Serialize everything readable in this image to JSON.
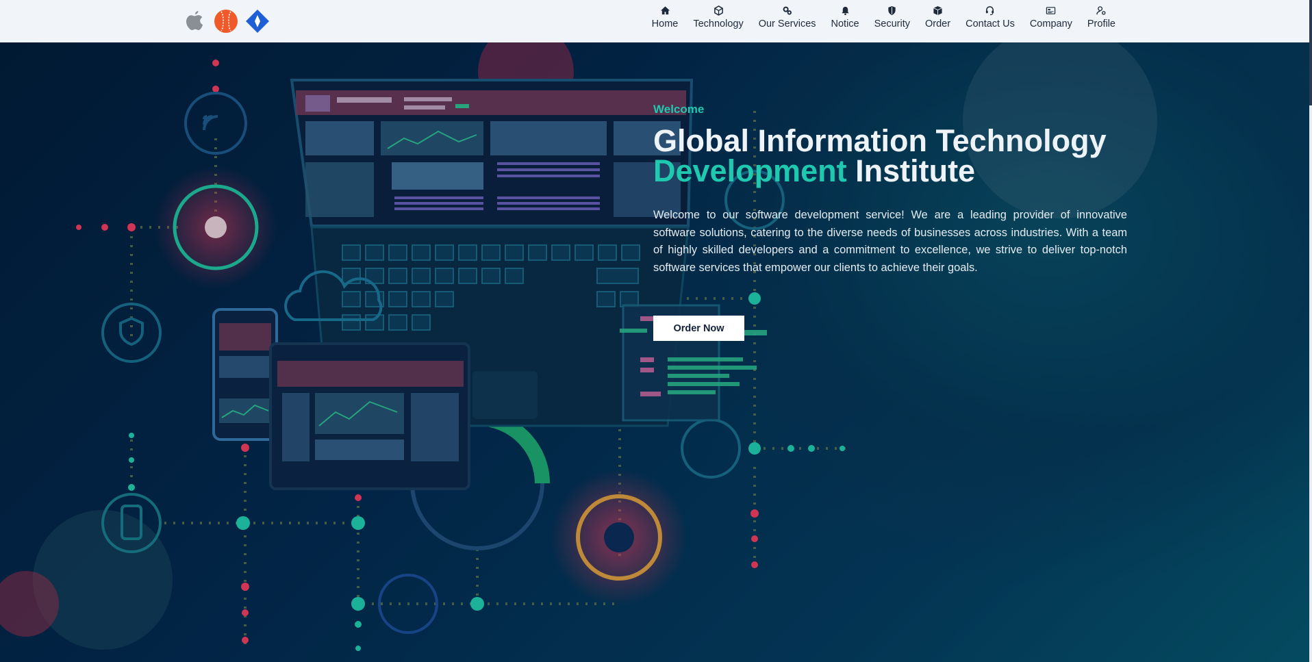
{
  "header": {
    "logos": [
      "apple-logo",
      "baseball-logo",
      "diamond-logo"
    ],
    "nav": [
      {
        "label": "Home",
        "icon": "home-icon"
      },
      {
        "label": "Technology",
        "icon": "cube-icon"
      },
      {
        "label": "Our Services",
        "icon": "gears-icon"
      },
      {
        "label": "Notice",
        "icon": "bell-icon"
      },
      {
        "label": "Security",
        "icon": "shield-icon"
      },
      {
        "label": "Order",
        "icon": "box-icon"
      },
      {
        "label": "Contact Us",
        "icon": "headset-icon"
      },
      {
        "label": "Company",
        "icon": "building-card-icon"
      },
      {
        "label": "Profile",
        "icon": "user-gear-icon"
      }
    ]
  },
  "hero": {
    "kicker": "Welcome",
    "title_line1": "Global Information Technology",
    "title_accent": "Development",
    "title_rest": "Institute",
    "description": "Welcome to our software development service! We are a leading provider of innovative software solutions, catering to the diverse needs of businesses across industries. With a team of highly skilled developers and a commitment to excellence, we strive to deliver top-notch software services that empower our clients to achieve their goals.",
    "cta_label": "Order Now"
  },
  "colors": {
    "accent": "#1ec9b0",
    "header_bg": "#f1f4f8",
    "hero_bg": "#03243f",
    "logo_orange": "#f05a2a",
    "logo_blue": "#1f5fd6"
  }
}
